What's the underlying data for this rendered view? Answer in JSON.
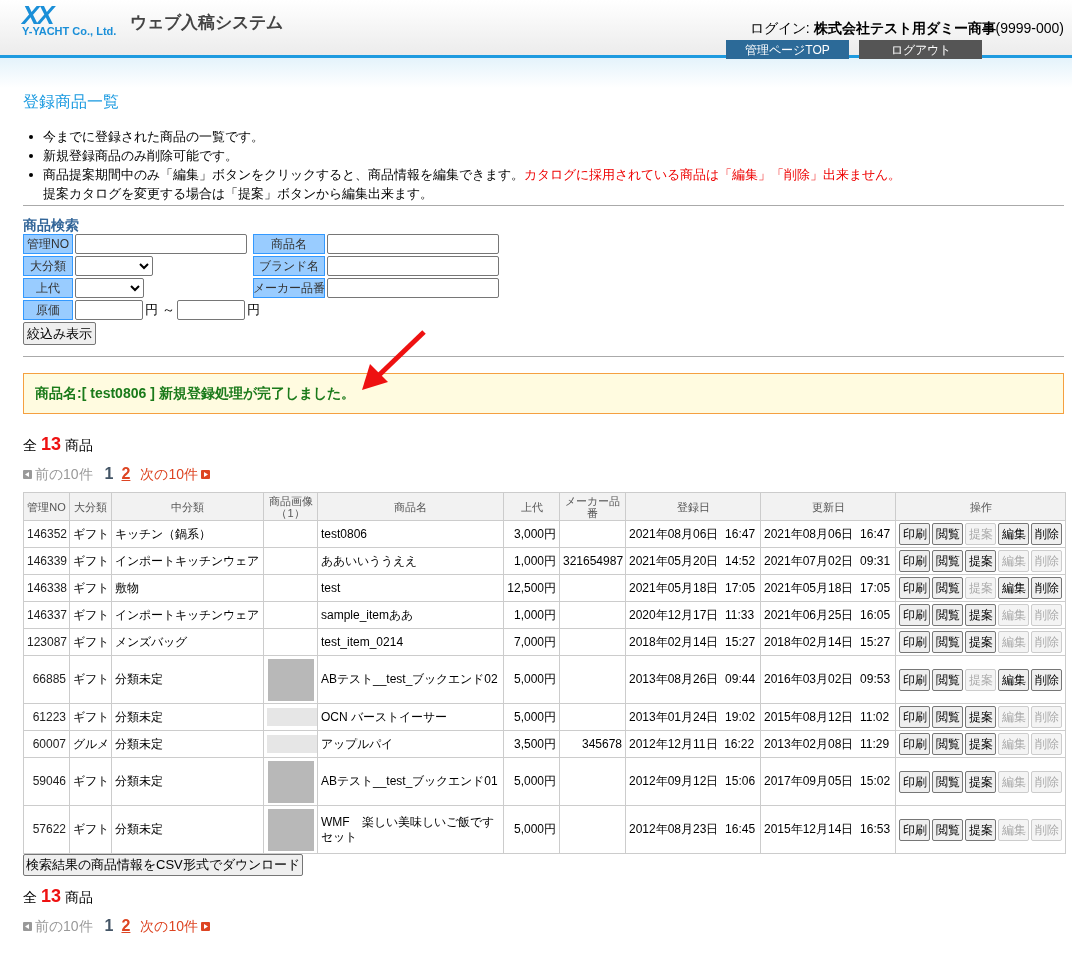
{
  "header": {
    "logo_mark": "XX",
    "logo_company": "Y-YACHT Co., Ltd.",
    "system_title": "ウェブ入稿システム",
    "login": "ログイン: **株式会社テスト用ダミー商事**(9999-000)",
    "nav": [
      {
        "label": "管理ページTOP",
        "kind": "primary"
      },
      {
        "label": "ログアウト",
        "kind": "secondary"
      }
    ]
  },
  "page_title": "登録商品一覧",
  "notes": [
    {
      "text": "今までに登録された商品の一覧です。"
    },
    {
      "text": "新規登録商品のみ削除可能です。"
    },
    {
      "text": "商品提案期間中のみ「編集」ボタンをクリックすると、商品情報を編集できます。",
      "warning": "カタログに採用されている商品は「編集」「削除」出来ません。",
      "continuation": "提案カタログを変更する場合は「提案」ボタンから編集出来ます。"
    }
  ],
  "search": {
    "title": "商品検索",
    "fields": [
      {
        "label": "管理NO",
        "kind": "text"
      },
      {
        "label": "商品名",
        "kind": "text"
      },
      {
        "label": "大分類",
        "kind": "select"
      },
      {
        "label": "ブランド名",
        "kind": "text"
      },
      {
        "label": "上代",
        "kind": "select"
      },
      {
        "label": "メーカー品番",
        "kind": "text"
      }
    ],
    "cost": {
      "label": "原価",
      "unit_from": "円 ～",
      "unit_to": "円"
    },
    "submit": "絞込み表示"
  },
  "message": "商品名:[ test0806 ] 新規登録処理が完了しました。",
  "total_top": {
    "prefix": "全",
    "count": "13",
    "suffix": "商品"
  },
  "pagination_top": {
    "prev": "前の10件",
    "prev_disabled": true,
    "pages": [
      {
        "label": "1",
        "selected": true
      },
      {
        "label": "2",
        "selected": false
      }
    ],
    "next": "次の10件"
  },
  "table": {
    "columns": [
      "管理NO",
      "大分類",
      "中分類",
      "商品画像（1）",
      "商品名",
      "上代",
      "メーカー品番",
      "登録日",
      "更新日",
      "操作"
    ],
    "rows": [
      {
        "no": "146352",
        "major": "ギフト",
        "mid": "キッチン（鍋系）",
        "kind": "plain",
        "name": "test0806",
        "price": "3,000円",
        "maker_no": "",
        "registered": "2021年08月06日  16:47",
        "updated": "2021年08月06日  16:47",
        "actions": [
          {
            "label": "印刷",
            "disabled": false
          },
          {
            "label": "閲覧",
            "disabled": false
          },
          {
            "label": "提案",
            "disabled": true
          },
          {
            "label": "編集",
            "disabled": false
          },
          {
            "label": "削除",
            "disabled": false
          }
        ]
      },
      {
        "no": "146339",
        "major": "ギフト",
        "mid": "インポートキッチンウェア",
        "kind": "plain",
        "name": "ああいいううええ",
        "price": "1,000円",
        "maker_no": "321654987",
        "registered": "2021年05月20日  14:52",
        "updated": "2021年07月02日  09:31",
        "actions": [
          {
            "label": "印刷",
            "disabled": false
          },
          {
            "label": "閲覧",
            "disabled": false
          },
          {
            "label": "提案",
            "disabled": false
          },
          {
            "label": "編集",
            "disabled": true
          },
          {
            "label": "削除",
            "disabled": true
          }
        ]
      },
      {
        "no": "146338",
        "major": "ギフト",
        "mid": "敷物",
        "kind": "plain",
        "name": "test",
        "price": "12,500円",
        "maker_no": "",
        "registered": "2021年05月18日  17:05",
        "updated": "2021年05月18日  17:05",
        "actions": [
          {
            "label": "印刷",
            "disabled": false
          },
          {
            "label": "閲覧",
            "disabled": false
          },
          {
            "label": "提案",
            "disabled": true
          },
          {
            "label": "編集",
            "disabled": false
          },
          {
            "label": "削除",
            "disabled": false
          }
        ]
      },
      {
        "no": "146337",
        "major": "ギフト",
        "mid": "インポートキッチンウェア",
        "kind": "plain",
        "name": "sample_itemああ",
        "price": "1,000円",
        "maker_no": "",
        "registered": "2020年12月17日  11:33",
        "updated": "2021年06月25日  16:05",
        "actions": [
          {
            "label": "印刷",
            "disabled": false
          },
          {
            "label": "閲覧",
            "disabled": false
          },
          {
            "label": "提案",
            "disabled": false
          },
          {
            "label": "編集",
            "disabled": true
          },
          {
            "label": "削除",
            "disabled": true
          }
        ]
      },
      {
        "no": "123087",
        "major": "ギフト",
        "mid": "メンズバッグ",
        "kind": "plain",
        "name": "test_item_0214",
        "price": "7,000円",
        "maker_no": "",
        "registered": "2018年02月14日  15:27",
        "updated": "2018年02月14日  15:27",
        "actions": [
          {
            "label": "印刷",
            "disabled": false
          },
          {
            "label": "閲覧",
            "disabled": false
          },
          {
            "label": "提案",
            "disabled": false
          },
          {
            "label": "編集",
            "disabled": true
          },
          {
            "label": "削除",
            "disabled": true
          }
        ]
      },
      {
        "no": "66885",
        "major": "ギフト",
        "mid": "分類未定",
        "kind": "photo",
        "name": "ABテスト__test_ブックエンド02",
        "price": "5,000円",
        "maker_no": "",
        "registered": "2013年08月26日  09:44",
        "updated": "2016年03月02日  09:53",
        "actions": [
          {
            "label": "印刷",
            "disabled": false
          },
          {
            "label": "閲覧",
            "disabled": false
          },
          {
            "label": "提案",
            "disabled": true
          },
          {
            "label": "編集",
            "disabled": false
          },
          {
            "label": "削除",
            "disabled": false
          }
        ]
      },
      {
        "no": "61223",
        "major": "ギフト",
        "mid": "分類未定",
        "kind": "banner",
        "name": "OCN バーストイーサー",
        "price": "5,000円",
        "maker_no": "",
        "registered": "2013年01月24日  19:02",
        "updated": "2015年08月12日  11:02",
        "actions": [
          {
            "label": "印刷",
            "disabled": false
          },
          {
            "label": "閲覧",
            "disabled": false
          },
          {
            "label": "提案",
            "disabled": false
          },
          {
            "label": "編集",
            "disabled": true
          },
          {
            "label": "削除",
            "disabled": true
          }
        ]
      },
      {
        "no": "60007",
        "major": "グルメ",
        "mid": "分類未定",
        "kind": "banner",
        "name": "アップルパイ",
        "price": "3,500円",
        "maker_no": "345678",
        "registered": "2012年12月11日  16:22",
        "updated": "2013年02月08日  11:29",
        "actions": [
          {
            "label": "印刷",
            "disabled": false
          },
          {
            "label": "閲覧",
            "disabled": false
          },
          {
            "label": "提案",
            "disabled": false
          },
          {
            "label": "編集",
            "disabled": true
          },
          {
            "label": "削除",
            "disabled": true
          }
        ]
      },
      {
        "no": "59046",
        "major": "ギフト",
        "mid": "分類未定",
        "kind": "photo",
        "name": "ABテスト__test_ブックエンド01",
        "price": "5,000円",
        "maker_no": "",
        "registered": "2012年09月12日  15:06",
        "updated": "2017年09月05日  15:02",
        "actions": [
          {
            "label": "印刷",
            "disabled": false
          },
          {
            "label": "閲覧",
            "disabled": false
          },
          {
            "label": "提案",
            "disabled": false
          },
          {
            "label": "編集",
            "disabled": true
          },
          {
            "label": "削除",
            "disabled": true
          }
        ]
      },
      {
        "no": "57622",
        "major": "ギフト",
        "mid": "分類未定",
        "kind": "photo",
        "name": "WMF　楽しい美味しいご飯ですセット",
        "price": "5,000円",
        "maker_no": "",
        "registered": "2012年08月23日  16:45",
        "updated": "2015年12月14日  16:53",
        "actions": [
          {
            "label": "印刷",
            "disabled": false
          },
          {
            "label": "閲覧",
            "disabled": false
          },
          {
            "label": "提案",
            "disabled": false
          },
          {
            "label": "編集",
            "disabled": true
          },
          {
            "label": "削除",
            "disabled": true
          }
        ]
      }
    ]
  },
  "csv_button": "検索結果の商品情報をCSV形式でダウンロード",
  "total_bottom": {
    "prefix": "全",
    "count": "13",
    "suffix": "商品"
  },
  "pagination_bottom": {
    "prev": "前の10件",
    "prev_disabled": true,
    "pages": [
      {
        "label": "1",
        "selected": true
      },
      {
        "label": "2",
        "selected": false
      }
    ],
    "next": "次の10件"
  }
}
